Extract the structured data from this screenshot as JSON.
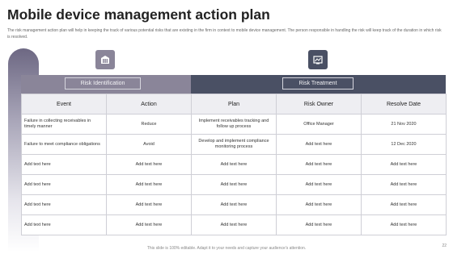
{
  "header": {
    "title": "Mobile device management action plan",
    "description": "The risk management action plan will help in keeping the track of various potential risks that are existing in the firm in context to mobile device management. The person responsible in handling the risk will keep track of the duration in which risk is resolved."
  },
  "icons": {
    "left": "building-icon",
    "right": "risk-board-icon"
  },
  "sections": {
    "left_label": "Risk Identification",
    "right_label": "Risk Treatment"
  },
  "table": {
    "columns": [
      "Event",
      "Action",
      "Plan",
      "Risk Owner",
      "Resolve Date"
    ],
    "rows": [
      [
        "Failure in collecting receivables in timely manner",
        "Reduce",
        "Implement receivables tracking and follow up process",
        "Office Manager",
        "21 Nov 2020"
      ],
      [
        "Failure to meet compliance obligations",
        "Avoid",
        "Develop and implement compliance monitoring process",
        "Add text here",
        "12 Dec 2020"
      ],
      [
        "Add text here",
        "Add text here",
        "Add text here",
        "Add text here",
        "Add text here"
      ],
      [
        "Add text here",
        "Add text here",
        "Add text here",
        "Add text here",
        "Add text here"
      ],
      [
        "Add text here",
        "Add text here",
        "Add text here",
        "Add text here",
        "Add text here"
      ],
      [
        "Add text here",
        "Add text here",
        "Add text here",
        "Add text here",
        "Add text here"
      ]
    ]
  },
  "footer": {
    "note": "This slide is 100% editable. Adapt it to your needs and capture your audience's attention.",
    "page_number": "22"
  },
  "colors": {
    "accent_light": "#8a8599",
    "accent_dark": "#4a5064"
  }
}
